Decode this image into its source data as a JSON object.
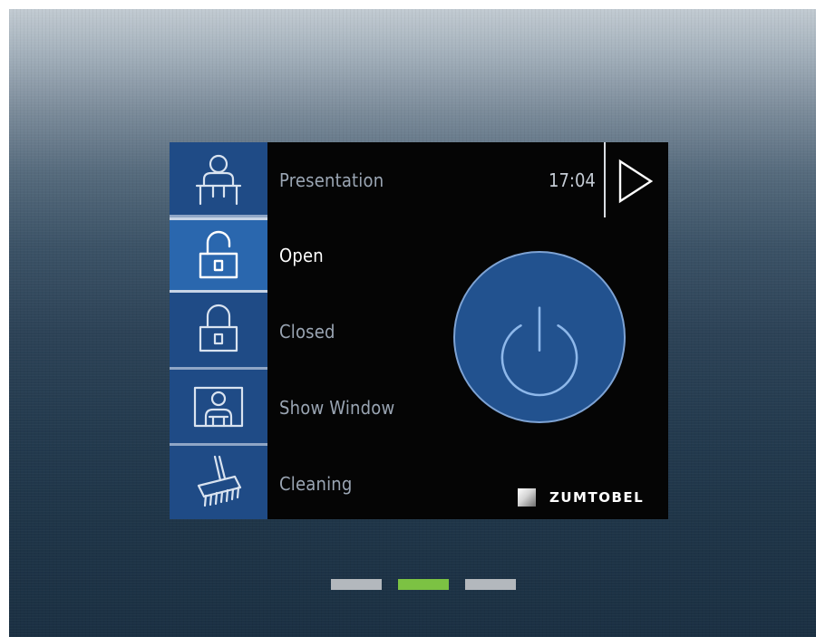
{
  "header": {
    "time": "17:04",
    "next_icon": "play-triangle-icon"
  },
  "modes": [
    {
      "label": "Presentation",
      "icon": "presenter-person-icon",
      "selected": false
    },
    {
      "label": "Open",
      "icon": "padlock-open-icon",
      "selected": true
    },
    {
      "label": "Closed",
      "icon": "padlock-closed-icon",
      "selected": false
    },
    {
      "label": "Show Window",
      "icon": "show-window-person-icon",
      "selected": false
    },
    {
      "label": "Cleaning",
      "icon": "broom-icon",
      "selected": false
    }
  ],
  "power": {
    "icon": "power-icon"
  },
  "brand": {
    "name": "ZUMTOBEL"
  },
  "pagination": {
    "pages": 3,
    "active_index": 1
  },
  "colors": {
    "sidebar": "#1f4b86",
    "sidebar_active": "#2a67ae",
    "power_button": "#22528f",
    "page_active": "#7cc243",
    "page_inactive": "#b3b8bd"
  }
}
